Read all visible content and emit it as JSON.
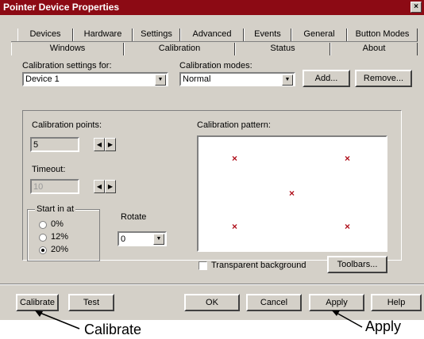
{
  "window": {
    "title": "Pointer Device Properties",
    "close_glyph": "×"
  },
  "tabs": {
    "row1": [
      "Devices",
      "Hardware",
      "Settings",
      "Advanced",
      "Events",
      "General",
      "Button Modes"
    ],
    "row2": [
      "Windows",
      "Calibration",
      "Status",
      "About"
    ],
    "active": "Calibration"
  },
  "calibration_settings": {
    "label": "Calibration settings for:",
    "value": "Device 1"
  },
  "calibration_modes": {
    "label": "Calibration modes:",
    "value": "Normal"
  },
  "buttons_top": {
    "add": "Add...",
    "remove": "Remove..."
  },
  "points": {
    "label": "Calibration points:",
    "value": "5"
  },
  "timeout": {
    "label": "Timeout:",
    "value": "10"
  },
  "start_in_at": {
    "label": "Start in at",
    "options": [
      "0%",
      "12%",
      "20%"
    ],
    "selected": "20%"
  },
  "rotate": {
    "label": "Rotate",
    "value": "0"
  },
  "pattern": {
    "label": "Calibration pattern:",
    "mark": "×",
    "mark_color": "#b0101c"
  },
  "transparent_background": {
    "label": "Transparent background",
    "checked": false
  },
  "toolbars_button": "Toolbars...",
  "bottom_buttons": {
    "calibrate": "Calibrate",
    "test": "Test",
    "ok": "OK",
    "cancel": "Cancel",
    "apply": "Apply",
    "help": "Help"
  },
  "annotations": {
    "calibrate": "Calibrate",
    "apply": "Apply"
  },
  "colors": {
    "titlebar": "#8c0a14",
    "face": "#d4d0c8"
  },
  "icons": {
    "spin_left": "arrow-left-icon",
    "spin_right": "arrow-right-icon",
    "dropdown": "chevron-down-icon"
  }
}
